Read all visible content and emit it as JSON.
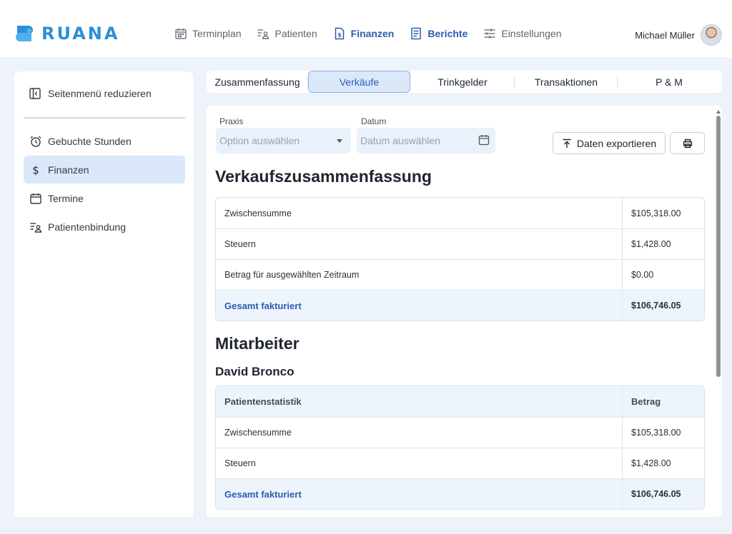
{
  "brand": {
    "name": "RUANA",
    "color": "#2c8fd8"
  },
  "nav": {
    "items": [
      {
        "label": "Terminplan",
        "icon": "calendar-icon",
        "active": false
      },
      {
        "label": "Patienten",
        "icon": "patient-list-icon",
        "active": false
      },
      {
        "label": "Finanzen",
        "icon": "invoice-icon",
        "active": true
      },
      {
        "label": "Berichte",
        "icon": "report-icon",
        "active": true
      },
      {
        "label": "Einstellungen",
        "icon": "sliders-icon",
        "active": false
      }
    ]
  },
  "user": {
    "name": "Michael Müller"
  },
  "sidebar": {
    "collapse_label": "Seitenmenü reduzieren",
    "items": [
      {
        "label": "Gebuchte Stunden",
        "icon": "alarm-clock-icon",
        "active": false
      },
      {
        "label": "Finanzen",
        "icon": "dollar-icon",
        "active": true
      },
      {
        "label": "Termine",
        "icon": "calendar-icon",
        "active": false
      },
      {
        "label": "Patientenbindung",
        "icon": "patient-list-icon",
        "active": false
      }
    ]
  },
  "tabs": [
    {
      "label": "Zusammenfassung",
      "active": false
    },
    {
      "label": "Verkäufe",
      "active": true
    },
    {
      "label": "Trinkgelder",
      "active": false
    },
    {
      "label": "Transaktionen",
      "active": false
    },
    {
      "label": "P & M",
      "active": false
    }
  ],
  "filters": {
    "praxis_label": "Praxis",
    "praxis_placeholder": "Option auswählen",
    "datum_label": "Datum",
    "datum_placeholder": "Datum auswählen",
    "export_label": "Daten exportieren"
  },
  "summary": {
    "title": "Verkaufszusammenfassung",
    "rows": [
      {
        "label": "Zwischensumme",
        "value": "$105,318.00"
      },
      {
        "label": "Steuern",
        "value": "$1,428.00"
      },
      {
        "label": "Betrag für ausgewählten Zeitraum",
        "value": "$0.00"
      }
    ],
    "total": {
      "label": "Gesamt fakturiert",
      "value": "$106,746.05"
    }
  },
  "staff": {
    "title": "Mitarbeiter",
    "person": "David Bronco",
    "header": {
      "label": "Patientenstatistik",
      "value": "Betrag"
    },
    "rows": [
      {
        "label": "Zwischensumme",
        "value": "$105,318.00"
      },
      {
        "label": "Steuern",
        "value": "$1,428.00"
      }
    ],
    "total": {
      "label": "Gesamt fakturiert",
      "value": "$106,746.05"
    }
  }
}
